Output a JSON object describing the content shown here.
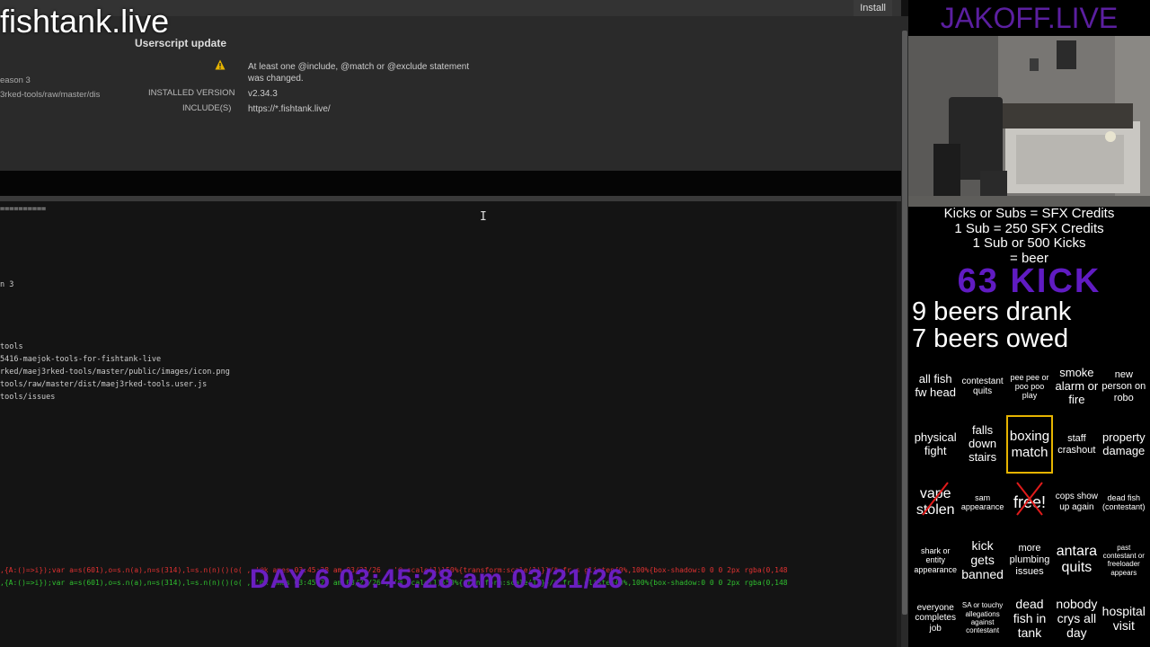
{
  "watermark": "fishtank.live",
  "userscript": {
    "install_label": "Install",
    "section_title": "Userscript update",
    "meta_line1": "eason 3",
    "meta_line2": "3rked-tools/raw/master/dis",
    "warning_text": "At least one @include, @match or @exclude statement was changed.",
    "installed_version_label": "INSTALLED VERSION",
    "installed_version_value": "v2.34.3",
    "includes_label": "INCLUDE(S)",
    "includes_value": "https://*.fishtank.live/"
  },
  "editor": {
    "lines": [
      "==========",
      "n 3",
      "tools",
      "5416-maejok-tools-for-fishtank-live",
      "rked/maej3rked-tools/master/public/images/icon.png",
      "tools/raw/master/dist/maej3rked-tools.user.js",
      "tools/issues"
    ],
    "overlay_red": ",{A:()=>i});var a=s(601),o=s.n(a),n=s(314),l=s.n(n)()(o(  ,,'@k ames  03:45:28 am  03/21/26 ,,'@ scale(1)}50%{transform:scale(1)}}/* fr  s glisten{0%,100%{box-shadow:0 0 0 2px rgba(0,148",
    "overlay_green": ",{A:()=>i});var a=s(601),o=s.n(a),n=s(314),l=s.n(n)()(o(  ,,'@k ames  03:45:28 am  03/21/26 ,,'@ scale(1)}50%{transform:scale(1)}}/* fr  s glisten{0%,100%{box-shadow:0 0 0 2px rgba(0,148"
  },
  "day_stamp": "DAY 6  03:45:28 am  03/21/26",
  "stream": {
    "brand": "JAKOFF.LIVE",
    "credits_lines": [
      "Kicks or Subs = SFX Credits",
      "1 Sub = 250 SFX Credits",
      "1 Sub or 500 Kicks",
      "= beer"
    ],
    "kicks": "63 KICK",
    "beers_drank": "9 beers drank",
    "beers_owed": "7 beers owed"
  },
  "bingo": [
    [
      "all fish fw head",
      "contestant quits",
      "pee pee or poo poo play",
      "smoke alarm or fire",
      "new person on robo"
    ],
    [
      "physical fight",
      "falls down stairs",
      "boxing match",
      "staff crashout",
      "property damage"
    ],
    [
      "vape stolen",
      "sam appearance",
      "free!",
      "cops show up again",
      "dead fish (contestant)"
    ],
    [
      "shark or entity appearance",
      "kick gets banned",
      "more plumbing issues",
      "antara quits",
      "past contestant or freeloader appears"
    ],
    [
      "everyone completes job",
      "SA or touchy allegations against contestant",
      "dead fish in tank",
      "nobody crys all day",
      "hospital visit"
    ]
  ],
  "colors": {
    "brand": "#5b1fa0",
    "kicks": "#6b1fd8",
    "day_stamp": "#6a1fc0",
    "highlight": "#e6b400",
    "cross": "#e01b1b"
  }
}
